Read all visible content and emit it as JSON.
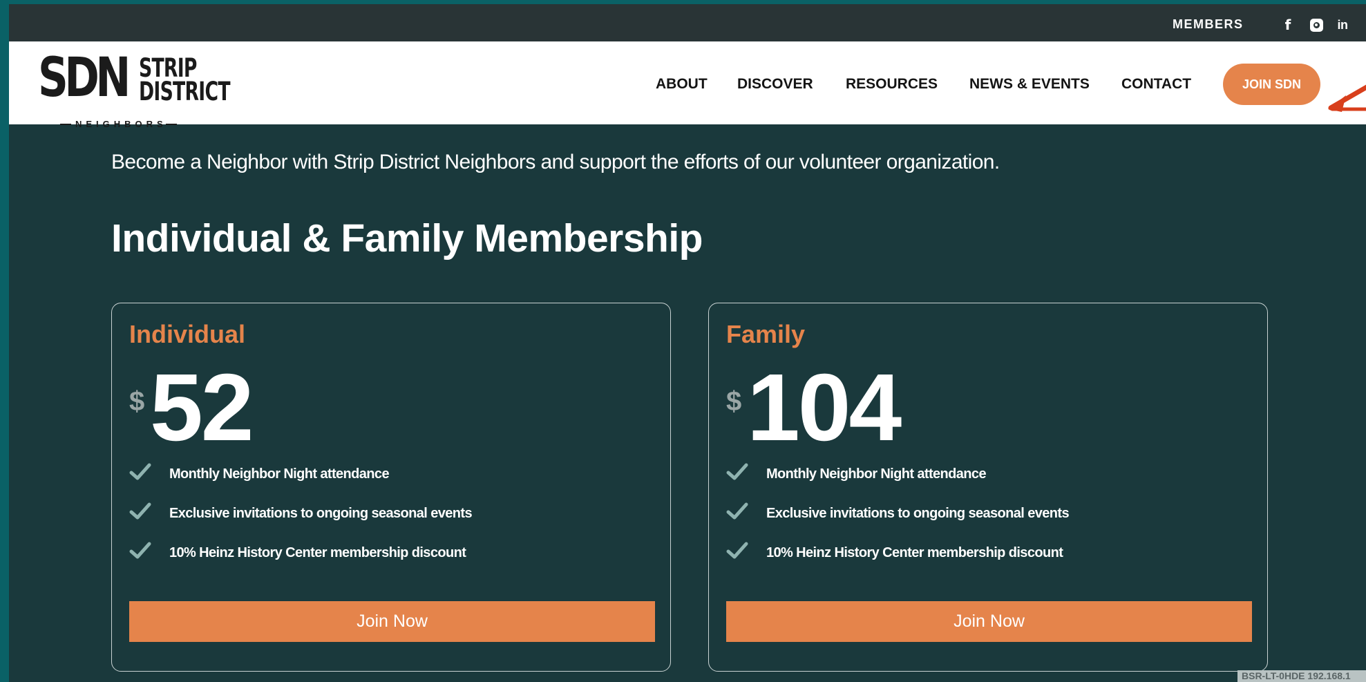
{
  "topbar": {
    "members_label": "MEMBERS",
    "social_icons": [
      "facebook-icon",
      "instagram-icon",
      "linkedin-icon"
    ],
    "facebook_glyph": "f",
    "linkedin_glyph": "in"
  },
  "header": {
    "logo": {
      "initials": "SDN",
      "line1": "STRIP",
      "line2": "DISTRICT",
      "tagline": "NEIGHBORS"
    },
    "nav": [
      "ABOUT",
      "DISCOVER",
      "RESOURCES",
      "NEWS & EVENTS",
      "CONTACT"
    ],
    "cta_label": "JOIN SDN"
  },
  "main": {
    "intro": "Become a Neighbor with Strip District Neighbors and support the efforts of our volunteer organization.",
    "section_title": "Individual & Family Membership",
    "cards": [
      {
        "title": "Individual",
        "currency": "$",
        "price": "52",
        "features": [
          "Monthly Neighbor Night attendance",
          "Exclusive invitations to ongoing seasonal events",
          "10% Heinz History Center membership discount"
        ],
        "button": "Join Now"
      },
      {
        "title": "Family",
        "currency": "$",
        "price": "104",
        "features": [
          "Monthly Neighbor Night attendance",
          "Exclusive invitations to ongoing seasonal events",
          "10% Heinz History Center membership discount"
        ],
        "button": "Join Now"
      }
    ]
  },
  "host_label": "BSR-LT-0HDE 192.168.1",
  "colors": {
    "accent": "#e5844b",
    "background": "#1a393c",
    "topbar": "#293436",
    "header": "#ffffff"
  }
}
